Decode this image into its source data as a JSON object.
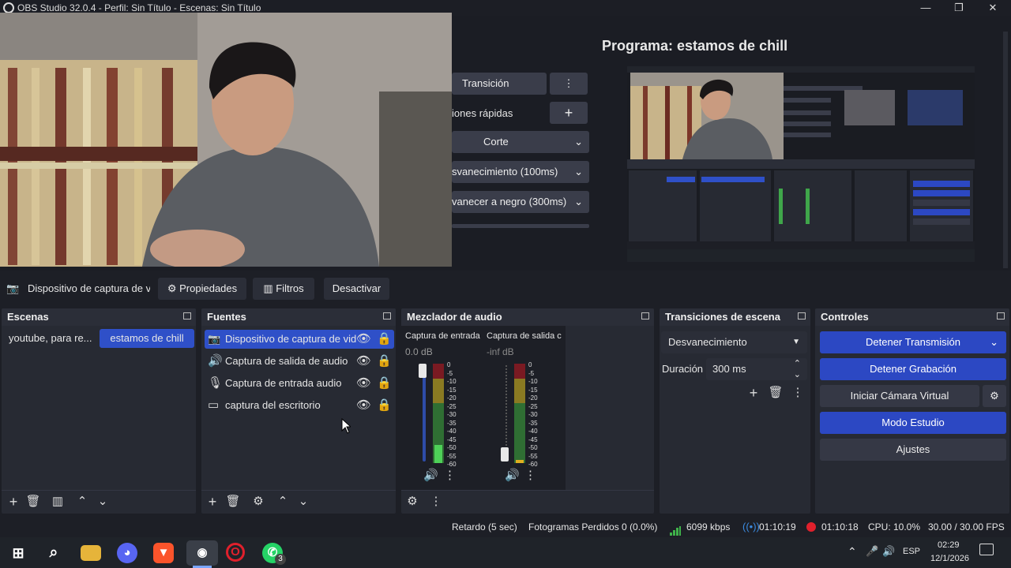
{
  "window": {
    "title": "OBS Studio 32.0.4 - Perfil: Sin Título - Escenas: Sin Título"
  },
  "transition_panel": {
    "transition_button": "Transición",
    "quick_transitions": "iones rápidas",
    "cut": "Corte",
    "fade": "svanecimiento (100ms)",
    "fade_black": "vanecer a negro (300ms)"
  },
  "program": {
    "label": "Programa: estamos de chill"
  },
  "source_toolbar": {
    "source_name": "Dispositivo de captura de v",
    "properties": "Propiedades",
    "filters": "Filtros",
    "deactivate": "Desactivar"
  },
  "scenes": {
    "title": "Escenas",
    "items": [
      {
        "label": "youtube, para re..."
      },
      {
        "label": "estamos de chill"
      }
    ]
  },
  "sources": {
    "title": "Fuentes",
    "items": [
      {
        "label": "Dispositivo de captura de vid",
        "icon": "camera-icon"
      },
      {
        "label": "Captura de salida de audio",
        "icon": "speaker-icon"
      },
      {
        "label": "Captura de entrada audio",
        "icon": "microphone-icon"
      },
      {
        "label": "captura del escritorio",
        "icon": "monitor-icon"
      }
    ]
  },
  "mixer": {
    "title": "Mezclador de audio",
    "channels": [
      {
        "name": "Captura de entrada",
        "db": "0.0 dB",
        "fill": 0.18
      },
      {
        "name": "Captura de salida c",
        "db": "-inf dB",
        "fill": 0
      }
    ],
    "ticks": [
      "0",
      "-5",
      "-10",
      "-15",
      "-20",
      "-25",
      "-30",
      "-35",
      "-40",
      "-45",
      "-50",
      "-55",
      "-60"
    ]
  },
  "transitions": {
    "title": "Transiciones de escena",
    "selected": "Desvanecimiento",
    "duration_label": "Duración",
    "duration_value": "300 ms"
  },
  "controls": {
    "title": "Controles",
    "stop_stream": "Detener Transmisión",
    "stop_recording": "Detener Grabación",
    "virtual_cam": "Iniciar Cámara Virtual",
    "studio_mode": "Modo Estudio",
    "settings": "Ajustes"
  },
  "statusbar": {
    "delay": "Retardo (5 sec)",
    "dropped": "Fotogramas Perdidos 0 (0.0%)",
    "bitrate": "6099 kbps",
    "stream_time": "01:10:19",
    "rec_time": "01:10:18",
    "cpu": "CPU: 10.0%",
    "fps": "30.00 / 30.00 FPS"
  },
  "taskbar": {
    "lang": "ESP",
    "time": "02:29",
    "date": "12/1/2026",
    "whatsapp_badge": "3"
  },
  "colors": {
    "accent": "#2c48c3",
    "record_red": "#e0202c",
    "stream_blue": "#3b8be0"
  }
}
